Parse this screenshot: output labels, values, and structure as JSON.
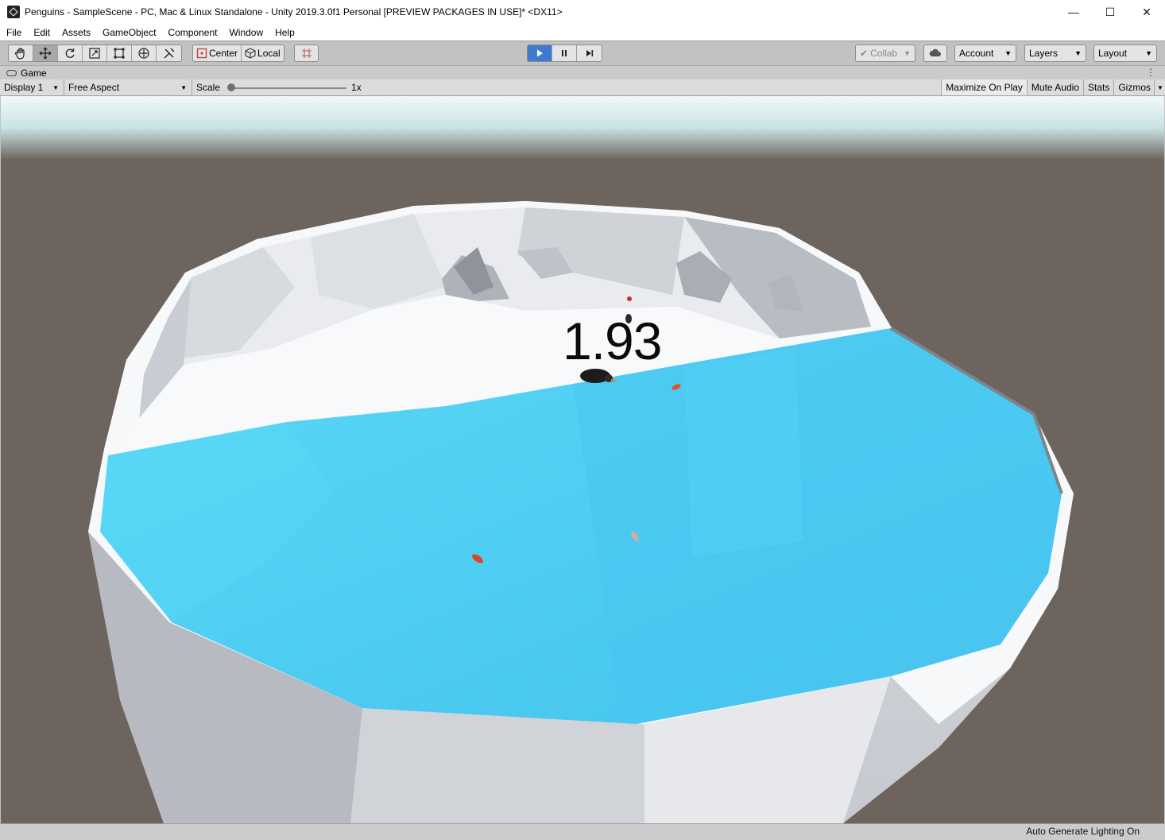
{
  "window": {
    "title": "Penguins - SampleScene - PC, Mac & Linux Standalone - Unity 2019.3.0f1 Personal [PREVIEW PACKAGES IN USE]* <DX11>",
    "controls": {
      "minimize": "—",
      "maximize": "☐",
      "close": "✕"
    }
  },
  "menu": [
    "File",
    "Edit",
    "Assets",
    "GameObject",
    "Component",
    "Window",
    "Help"
  ],
  "toolbar": {
    "tools": [
      "hand-tool",
      "move-tool",
      "rotate-tool",
      "scale-tool",
      "rect-tool",
      "transform-tool",
      "custom-tool"
    ],
    "active_tool": "move-tool",
    "pivot_label": "Center",
    "space_label": "Local",
    "play_state": "playing",
    "collab_label": "Collab",
    "account_label": "Account",
    "layers_label": "Layers",
    "layout_label": "Layout"
  },
  "game_tab": {
    "label": "Game"
  },
  "game_bar": {
    "display": "Display 1",
    "aspect": "Free Aspect",
    "scale_label": "Scale",
    "scale_value": "1x",
    "maximize_on_play": "Maximize On Play",
    "mute_audio": "Mute Audio",
    "stats": "Stats",
    "gizmos": "Gizmos"
  },
  "scene": {
    "score": "1.93",
    "colors": {
      "ground": "#6e655f",
      "ice": "#f4f6f8",
      "water": "#4fd0f2",
      "sky_top": "#c8e4e6"
    }
  },
  "status": {
    "text": "Auto Generate Lighting On"
  }
}
